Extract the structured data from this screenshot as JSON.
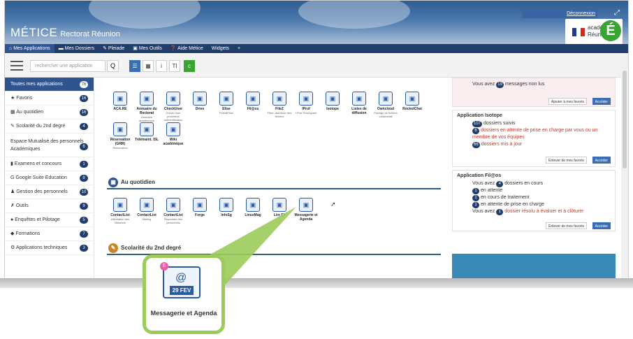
{
  "header": {
    "brand": "MÉTICE",
    "brand_sub": "Rectorat Réunion",
    "user": "Déconnexion",
    "academie": "académie La Réunion",
    "academie_letter": "É"
  },
  "nav": {
    "items": [
      "Mes Applications",
      "Mes Dossiers",
      "Pleiade",
      "Mes Outils",
      "Aide Métice",
      "Widgets",
      "+"
    ]
  },
  "toolbar": {
    "search_placeholder": "rechercher une application",
    "search_icon": "Q",
    "view_list": "☰",
    "view_grid": "▦",
    "info": "i",
    "text": "TI",
    "refresh": "c"
  },
  "sidebar": {
    "items": [
      {
        "label": "Toutes mes applications",
        "badge": "76"
      },
      {
        "label": "Favoris",
        "badge": "16"
      },
      {
        "label": "Au quotidien",
        "badge": "16"
      },
      {
        "label": "Scolarité du 2nd degré",
        "badge": "4"
      },
      {
        "label": "Espace Mutualisé des personnels Académiques",
        "badge": "6"
      },
      {
        "label": "Examens et concours",
        "badge": "1"
      },
      {
        "label": "Google Suite Education",
        "badge": "8"
      },
      {
        "label": "Gestion des personnels",
        "badge": "10"
      },
      {
        "label": "Outils",
        "badge": "9"
      },
      {
        "label": "Enquêtes et Pilotage",
        "badge": "5"
      },
      {
        "label": "Formations",
        "badge": "7"
      },
      {
        "label": "Applications techniques",
        "badge": "3"
      }
    ]
  },
  "favoris": {
    "row1": [
      {
        "name": "ACA.RE",
        "sub": ""
      },
      {
        "name": "Annuaire du Rectorat",
        "sub": "Annuaire académique"
      },
      {
        "name": "CheckUser",
        "sub": "Check User procédure authentification"
      },
      {
        "name": "Drive",
        "sub": ""
      },
      {
        "name": "Elise",
        "sub": "PortailElise"
      },
      {
        "name": "Fil@os",
        "sub": ""
      },
      {
        "name": "FileZ",
        "sub": "Filez: distribuer des fichiers"
      },
      {
        "name": "IProf",
        "sub": "I-Prof Enseignant"
      },
      {
        "name": "Isotope",
        "sub": ""
      },
      {
        "name": "Listes de diffusion",
        "sub": ""
      },
      {
        "name": "Owncloud",
        "sub": "Partage de fichiers collaboratif"
      },
      {
        "name": "RocketChat",
        "sub": ""
      }
    ],
    "row2": [
      {
        "name": "Réservation (GRR)",
        "sub": "Réservation"
      },
      {
        "name": "Télémaint. ISL",
        "sub": ""
      },
      {
        "name": "Wiki académique",
        "sub": ""
      }
    ]
  },
  "quotidien": {
    "title": "Au quotidien",
    "apps": [
      {
        "name": "ContactList",
        "sub": "Affectation des Missions"
      },
      {
        "name": "ContactList",
        "sub": "Mailing"
      },
      {
        "name": "ContactList",
        "sub": "Répertoire des personnels"
      },
      {
        "name": "Forge",
        "sub": ""
      },
      {
        "name": "InfoSg",
        "sub": ""
      },
      {
        "name": "LinuxMag",
        "sub": ""
      },
      {
        "name": "Lire Fil",
        "sub": ""
      },
      {
        "name": "Messagerie et Agenda",
        "sub": ""
      }
    ]
  },
  "scolarite": {
    "title": "Scolarité du 2nd degré"
  },
  "right": {
    "messages": {
      "pre": "Vous avez",
      "count": "19",
      "post": "messages non lus",
      "fav_btn": "Ajouter à mes favoris",
      "open_btn": "Accéder"
    },
    "isotope": {
      "title": "Application Isotope",
      "l1_count": "107",
      "l1": "dossiers suivis",
      "l2_count": "6",
      "l2": "dossiers en attente de prise en charge par vous ou un membre de vos équipes",
      "l3_count": "66",
      "l3": "dossiers mis à jour",
      "fav_btn": "Enlever de mes favoris",
      "open_btn": "Accéder"
    },
    "filaos": {
      "title": "Application Fil@os",
      "l1_pre": "Vous avez",
      "l1_count": "4",
      "l1": "dossiers en cours",
      "l2_count": "1",
      "l2": "en attente",
      "l3_count": "1",
      "l3": "en cours de traitement",
      "l4_count": "1",
      "l4": "en attente de prise en charge",
      "l5_pre": "Vous avez",
      "l5_count": "1",
      "l5": "dossier résolu à évaluer et à clôturer",
      "fav_btn": "Enlever de mes favoris",
      "open_btn": "Accéder"
    }
  },
  "zoom": {
    "label": "Messagerie et Agenda",
    "date": "29 FEV",
    "badge": "E"
  }
}
